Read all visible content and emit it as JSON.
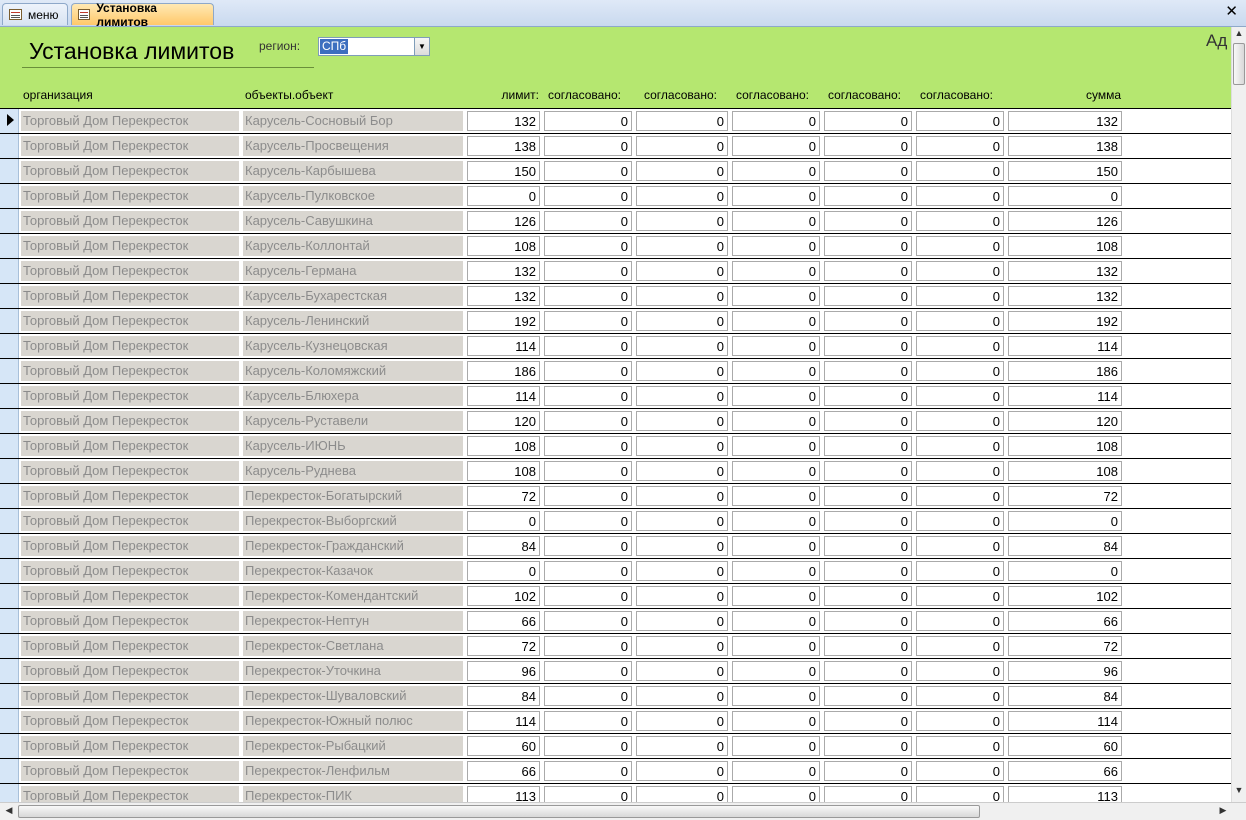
{
  "tabs": [
    {
      "label": "меню",
      "active": false
    },
    {
      "label": "Установка лимитов",
      "active": true
    }
  ],
  "header": {
    "title": "Установка лимитов",
    "region_label": "регион:",
    "region_value": "СПб",
    "side_text": "Ад"
  },
  "columns": [
    "организация",
    "объекты.объект",
    "лимит:",
    "согласовано:",
    "согласовано:",
    "согласовано:",
    "согласовано:",
    "согласовано:",
    "сумма"
  ],
  "rows": [
    {
      "org": "Торговый Дом Перекресток",
      "obj": "Карусель-Сосновый Бор",
      "limit": "132",
      "a1": "0",
      "a2": "0",
      "a3": "0",
      "a4": "0",
      "a5": "0",
      "sum": "132"
    },
    {
      "org": "Торговый Дом Перекресток",
      "obj": "Карусель-Просвещения",
      "limit": "138",
      "a1": "0",
      "a2": "0",
      "a3": "0",
      "a4": "0",
      "a5": "0",
      "sum": "138"
    },
    {
      "org": "Торговый Дом Перекресток",
      "obj": "Карусель-Карбышева",
      "limit": "150",
      "a1": "0",
      "a2": "0",
      "a3": "0",
      "a4": "0",
      "a5": "0",
      "sum": "150"
    },
    {
      "org": "Торговый Дом Перекресток",
      "obj": "Карусель-Пулковское",
      "limit": "0",
      "a1": "0",
      "a2": "0",
      "a3": "0",
      "a4": "0",
      "a5": "0",
      "sum": "0"
    },
    {
      "org": "Торговый Дом Перекресток",
      "obj": "Карусель-Савушкина",
      "limit": "126",
      "a1": "0",
      "a2": "0",
      "a3": "0",
      "a4": "0",
      "a5": "0",
      "sum": "126"
    },
    {
      "org": "Торговый Дом Перекресток",
      "obj": "Карусель-Коллонтай",
      "limit": "108",
      "a1": "0",
      "a2": "0",
      "a3": "0",
      "a4": "0",
      "a5": "0",
      "sum": "108"
    },
    {
      "org": "Торговый Дом Перекресток",
      "obj": "Карусель-Германа",
      "limit": "132",
      "a1": "0",
      "a2": "0",
      "a3": "0",
      "a4": "0",
      "a5": "0",
      "sum": "132"
    },
    {
      "org": "Торговый Дом Перекресток",
      "obj": "Карусель-Бухарестская",
      "limit": "132",
      "a1": "0",
      "a2": "0",
      "a3": "0",
      "a4": "0",
      "a5": "0",
      "sum": "132"
    },
    {
      "org": "Торговый Дом Перекресток",
      "obj": "Карусель-Ленинский",
      "limit": "192",
      "a1": "0",
      "a2": "0",
      "a3": "0",
      "a4": "0",
      "a5": "0",
      "sum": "192"
    },
    {
      "org": "Торговый Дом Перекресток",
      "obj": "Карусель-Кузнецовская",
      "limit": "114",
      "a1": "0",
      "a2": "0",
      "a3": "0",
      "a4": "0",
      "a5": "0",
      "sum": "114"
    },
    {
      "org": "Торговый Дом Перекресток",
      "obj": "Карусель-Коломяжский",
      "limit": "186",
      "a1": "0",
      "a2": "0",
      "a3": "0",
      "a4": "0",
      "a5": "0",
      "sum": "186"
    },
    {
      "org": "Торговый Дом Перекресток",
      "obj": "Карусель-Блюхера",
      "limit": "114",
      "a1": "0",
      "a2": "0",
      "a3": "0",
      "a4": "0",
      "a5": "0",
      "sum": "114"
    },
    {
      "org": "Торговый Дом Перекресток",
      "obj": "Карусель-Руставели",
      "limit": "120",
      "a1": "0",
      "a2": "0",
      "a3": "0",
      "a4": "0",
      "a5": "0",
      "sum": "120"
    },
    {
      "org": "Торговый Дом Перекресток",
      "obj": "Карусель-ИЮНЬ",
      "limit": "108",
      "a1": "0",
      "a2": "0",
      "a3": "0",
      "a4": "0",
      "a5": "0",
      "sum": "108"
    },
    {
      "org": "Торговый Дом Перекресток",
      "obj": "Карусель-Руднева",
      "limit": "108",
      "a1": "0",
      "a2": "0",
      "a3": "0",
      "a4": "0",
      "a5": "0",
      "sum": "108"
    },
    {
      "org": "Торговый Дом Перекресток",
      "obj": "Перекресток-Богатырский",
      "limit": "72",
      "a1": "0",
      "a2": "0",
      "a3": "0",
      "a4": "0",
      "a5": "0",
      "sum": "72"
    },
    {
      "org": "Торговый Дом Перекресток",
      "obj": "Перекресток-Выборгский",
      "limit": "0",
      "a1": "0",
      "a2": "0",
      "a3": "0",
      "a4": "0",
      "a5": "0",
      "sum": "0"
    },
    {
      "org": "Торговый Дом Перекресток",
      "obj": "Перекресток-Гражданский",
      "limit": "84",
      "a1": "0",
      "a2": "0",
      "a3": "0",
      "a4": "0",
      "a5": "0",
      "sum": "84"
    },
    {
      "org": "Торговый Дом Перекресток",
      "obj": "Перекресток-Казачок",
      "limit": "0",
      "a1": "0",
      "a2": "0",
      "a3": "0",
      "a4": "0",
      "a5": "0",
      "sum": "0"
    },
    {
      "org": "Торговый Дом Перекресток",
      "obj": "Перекресток-Комендантский",
      "limit": "102",
      "a1": "0",
      "a2": "0",
      "a3": "0",
      "a4": "0",
      "a5": "0",
      "sum": "102"
    },
    {
      "org": "Торговый Дом Перекресток",
      "obj": "Перекресток-Нептун",
      "limit": "66",
      "a1": "0",
      "a2": "0",
      "a3": "0",
      "a4": "0",
      "a5": "0",
      "sum": "66"
    },
    {
      "org": "Торговый Дом Перекресток",
      "obj": "Перекресток-Светлана",
      "limit": "72",
      "a1": "0",
      "a2": "0",
      "a3": "0",
      "a4": "0",
      "a5": "0",
      "sum": "72"
    },
    {
      "org": "Торговый Дом Перекресток",
      "obj": "Перекресток-Уточкина",
      "limit": "96",
      "a1": "0",
      "a2": "0",
      "a3": "0",
      "a4": "0",
      "a5": "0",
      "sum": "96"
    },
    {
      "org": "Торговый Дом Перекресток",
      "obj": "Перекресток-Шуваловский",
      "limit": "84",
      "a1": "0",
      "a2": "0",
      "a3": "0",
      "a4": "0",
      "a5": "0",
      "sum": "84"
    },
    {
      "org": "Торговый Дом Перекресток",
      "obj": "Перекресток-Южный полюс",
      "limit": "114",
      "a1": "0",
      "a2": "0",
      "a3": "0",
      "a4": "0",
      "a5": "0",
      "sum": "114"
    },
    {
      "org": "Торговый Дом Перекресток",
      "obj": "Перекресток-Рыбацкий",
      "limit": "60",
      "a1": "0",
      "a2": "0",
      "a3": "0",
      "a4": "0",
      "a5": "0",
      "sum": "60"
    },
    {
      "org": "Торговый Дом Перекресток",
      "obj": "Перекресток-Ленфильм",
      "limit": "66",
      "a1": "0",
      "a2": "0",
      "a3": "0",
      "a4": "0",
      "a5": "0",
      "sum": "66"
    },
    {
      "org": "Торговый Дом Перекресток",
      "obj": "Перекресток-ПИК",
      "limit": "113",
      "a1": "0",
      "a2": "0",
      "a3": "0",
      "a4": "0",
      "a5": "0",
      "sum": "113"
    }
  ],
  "colors": {
    "header_bg": "#b5e770",
    "tab_active": "#ffc86a",
    "record_selector": "#d6e6f7"
  },
  "icons": {
    "tab_icon": "form-icon",
    "close": "close-icon",
    "combo": "chevron-down-icon"
  }
}
